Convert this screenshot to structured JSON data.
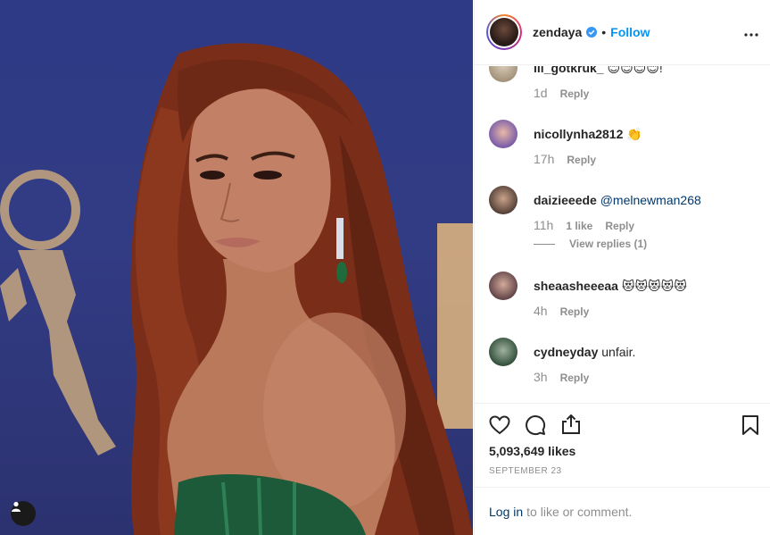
{
  "post": {
    "username": "zendaya",
    "follow_label": "Follow",
    "dot": "•"
  },
  "comments": [
    {
      "username": "lil_gotkruk_",
      "text": "😊😊😊😊!",
      "time": "1d",
      "reply": "Reply"
    },
    {
      "username": "nicollynha2812",
      "text": "👏",
      "time": "17h",
      "reply": "Reply"
    },
    {
      "username": "daizieeede",
      "mention": "@melnewman268",
      "time": "11h",
      "likes": "1 like",
      "reply": "Reply",
      "view_replies": "View replies (1)"
    },
    {
      "username": "sheaasheeeaa",
      "text": "😻😻😻😻😻",
      "time": "4h",
      "reply": "Reply"
    },
    {
      "username": "cydneyday",
      "text": "unfair.",
      "time": "3h",
      "reply": "Reply"
    }
  ],
  "stats": {
    "likes": "5,093,649 likes",
    "date": "SEPTEMBER 23"
  },
  "login": {
    "link": "Log in",
    "rest": "to like or comment."
  },
  "colors": {
    "accent": "#0095f6",
    "mention": "#00376b",
    "muted": "#8e8e8e",
    "photo_bg": "#2e3a86"
  },
  "icons": [
    "heart-icon",
    "comment-icon",
    "share-icon",
    "bookmark-icon",
    "verified-icon",
    "more-options-icon",
    "user-tag-icon"
  ]
}
